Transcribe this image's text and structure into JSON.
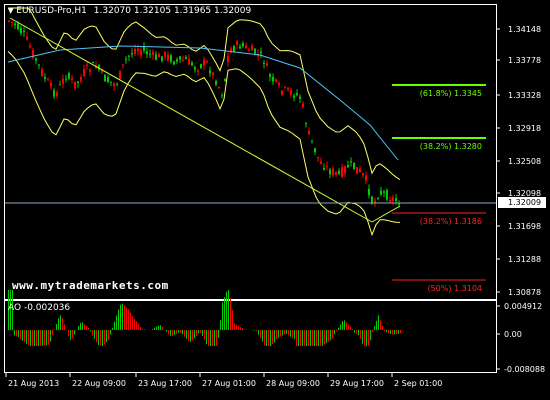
{
  "header": {
    "title": "EURUSD-Pro,H1",
    "ohlc": "1.32070 1.32105 1.31965 1.32009"
  },
  "indicator": {
    "label": "AO -0.002036"
  },
  "watermark": "www.mytrademarkets.com",
  "price_axis": {
    "ticks": [
      "1.34148",
      "1.33778",
      "1.33328",
      "1.32918",
      "1.32508",
      "1.32098",
      "1.31698",
      "1.31288",
      "1.30878"
    ],
    "current": "1.32009"
  },
  "ind_axis": {
    "ticks": [
      "0.004912",
      "0.00",
      "-0.008088"
    ]
  },
  "time_axis": [
    "21 Aug 2013",
    "22 Aug 09:00",
    "23 Aug 17:00",
    "27 Aug 01:00",
    "28 Aug 09:00",
    "29 Aug 17:00",
    "2 Sep 01:00"
  ],
  "fib_levels": [
    {
      "label": "(61.8%) 1.3345",
      "color": "#66ff00"
    },
    {
      "label": "(38.2%) 1.3280",
      "color": "#66ff00"
    },
    {
      "label": "(38.2%) 1.3186",
      "color": "#ff2020"
    },
    {
      "label": "(50%) 1.3104",
      "color": "#ff2020"
    }
  ],
  "colors": {
    "bull": "#00cc00",
    "bear": "#ff0000",
    "bands": "#ffff66",
    "ma": "#4fc3f7",
    "trendline": "#ccff33",
    "axis": "#ffffff"
  }
}
